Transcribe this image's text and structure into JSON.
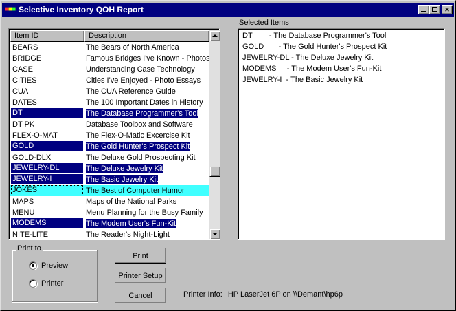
{
  "window": {
    "title": "Selective Inventory QOH Report"
  },
  "inventory_list": {
    "columns": [
      "Item ID",
      "Description"
    ],
    "rows": [
      {
        "id": "BEARS",
        "desc": "The Bears of North America",
        "selected": false
      },
      {
        "id": "BRIDGE",
        "desc": "Famous Bridges I've Known - Photos",
        "selected": false
      },
      {
        "id": "CASE",
        "desc": "Understanding Case Technology",
        "selected": false
      },
      {
        "id": "CITIES",
        "desc": "Cities I've Enjoyed - Photo Essays",
        "selected": false
      },
      {
        "id": "CUA",
        "desc": "The CUA Reference Guide",
        "selected": false
      },
      {
        "id": "DATES",
        "desc": "The 100 Important Dates in History",
        "selected": false
      },
      {
        "id": "DT",
        "desc": "The Database Programmer's Tool",
        "selected": true
      },
      {
        "id": "DT PK",
        "desc": "Database Toolbox and Software",
        "selected": false
      },
      {
        "id": "FLEX-O-MAT",
        "desc": "The Flex-O-Matic Excercise Kit",
        "selected": false
      },
      {
        "id": "GOLD",
        "desc": "The Gold Hunter's Prospect Kit",
        "selected": true
      },
      {
        "id": "GOLD-DLX",
        "desc": "The Deluxe Gold Prospecting Kit",
        "selected": false
      },
      {
        "id": "JEWELRY-DL",
        "desc": "The Deluxe Jewelry Kit",
        "selected": true
      },
      {
        "id": "JEWELRY-I",
        "desc": "The Basic Jewelry Kit",
        "selected": true
      },
      {
        "id": "JOKES",
        "desc": "The Best of Computer Humor",
        "selected": false,
        "focused": true
      },
      {
        "id": "MAPS",
        "desc": "Maps of the National Parks",
        "selected": false
      },
      {
        "id": "MENU",
        "desc": "Menu Planning for the Busy Family",
        "selected": false
      },
      {
        "id": "MODEMS",
        "desc": "The Modem User's Fun-Kit",
        "selected": true
      },
      {
        "id": "NITE-LITE",
        "desc": "The Reader's Night-Light",
        "selected": false
      }
    ]
  },
  "selected_items": {
    "label": "Selected Items",
    "items": [
      "DT        - The Database Programmer's Tool",
      "GOLD       - The Gold Hunter's Prospect Kit",
      "JEWELRY-DL - The Deluxe Jewelry Kit",
      "MODEMS     - The Modem User's Fun-Kit",
      "JEWELRY-I  - The Basic Jewelry Kit"
    ]
  },
  "print_to": {
    "label": "Print to",
    "options": [
      {
        "label": "Preview",
        "checked": true
      },
      {
        "label": "Printer",
        "checked": false
      }
    ]
  },
  "buttons": {
    "print": "Print",
    "printer_setup": "Printer Setup",
    "cancel": "Cancel"
  },
  "printer_info": {
    "label": "Printer Info:",
    "value": "HP LaserJet 6P on \\\\Demant\\hp6p"
  },
  "colors": {
    "titlebar": "#000080",
    "selection": "#000080",
    "focus_row": "#40ffff",
    "face": "#c0c0c0"
  }
}
